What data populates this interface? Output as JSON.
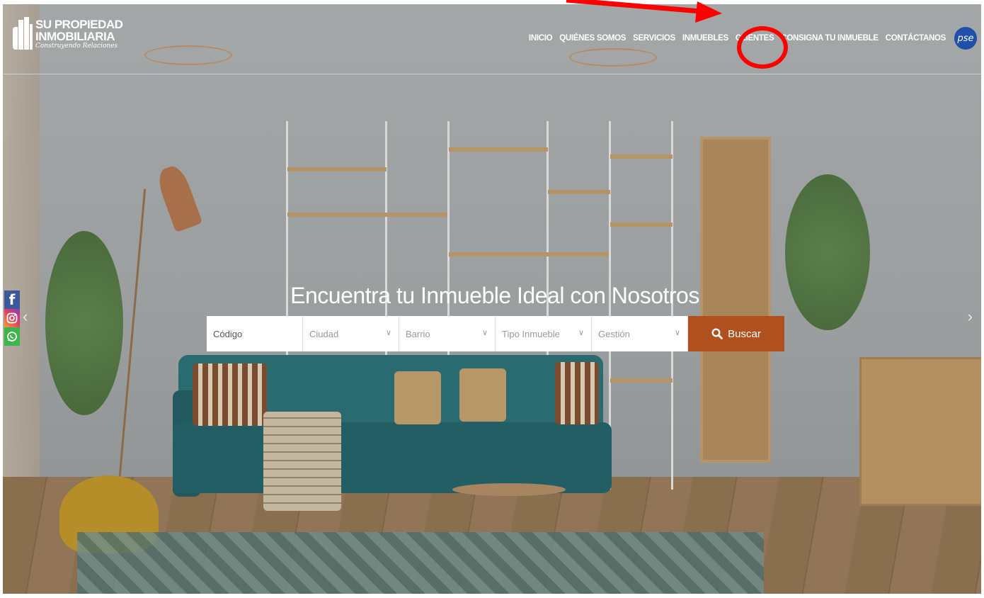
{
  "brand": {
    "line1": "SU PROPIEDAD",
    "line2": "INMOBILIARIA",
    "tagline": "Construyendo Relaciones"
  },
  "nav": {
    "items": [
      "INICIO",
      "QUIÉNES SOMOS",
      "SERVICIOS",
      "INMUEBLES",
      "CLIENTES",
      "CONSIGNA TU INMUEBLE",
      "CONTÁCTANOS"
    ],
    "pse_label": "pse"
  },
  "hero": {
    "title": "Encuentra tu Inmueble Ideal con Nosotros"
  },
  "search": {
    "code_placeholder": "Código",
    "city_placeholder": "Ciudad",
    "neighborhood_placeholder": "Barrio",
    "type_placeholder": "Tipo Inmueble",
    "management_placeholder": "Gestión",
    "button_label": "Buscar"
  },
  "social": {
    "facebook": "f"
  },
  "colors": {
    "accent": "#b0501e",
    "annotation": "#ff0000",
    "pse": "#1f4fa8"
  },
  "icons": {
    "search": "search-icon",
    "chevron": "chevron-down-icon",
    "slider_prev": "chevron-left-icon",
    "slider_next": "chevron-right-icon"
  }
}
